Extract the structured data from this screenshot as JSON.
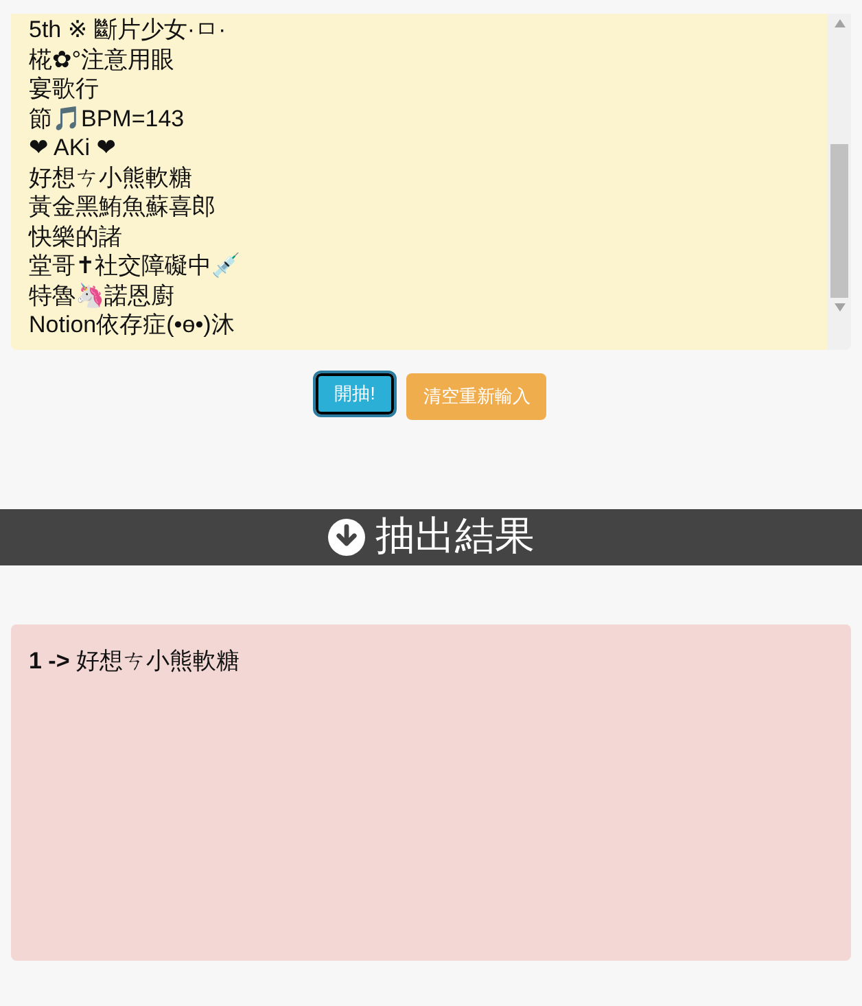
{
  "names_input": {
    "lines": [
      "5th ※ 斷片少女·ㅁ·",
      "椛✿°注意用眼",
      "宴歌行",
      "節🎵BPM=143",
      "❤ AKi ❤",
      "好想ㄘ小熊軟糖",
      "黃金黑鮪魚蘇喜郎",
      "快樂的諸",
      "堂哥✝社交障礙中💉",
      "特魯🦄諾恩廚",
      "Notion依存症(•ө•)沐"
    ]
  },
  "buttons": [
    {
      "label": "開抽!",
      "kind": "primary",
      "focused": true
    },
    {
      "label": "清空重新輸入",
      "kind": "warning",
      "focused": false
    }
  ],
  "section_header": {
    "title": "抽出結果"
  },
  "results": [
    "**1 ->** 好想ㄘ小熊軟糖"
  ]
}
